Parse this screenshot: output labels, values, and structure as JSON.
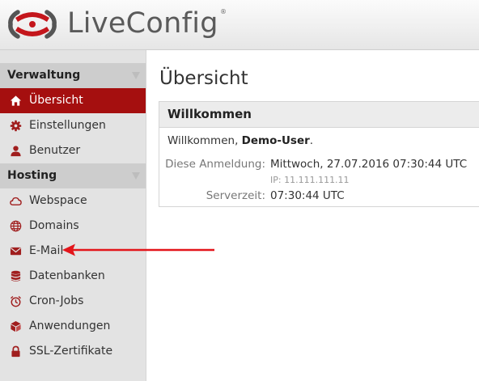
{
  "header": {
    "brand": "LiveConfig",
    "reg_mark": "®",
    "logo_icon": "liveconfig-logo-icon",
    "accent": "#a50f0f"
  },
  "sidebar": {
    "sections": [
      {
        "title": "Verwaltung",
        "items": [
          {
            "label": "Übersicht",
            "icon": "home-icon",
            "active": true
          },
          {
            "label": "Einstellungen",
            "icon": "gear-icon"
          },
          {
            "label": "Benutzer",
            "icon": "user-icon"
          }
        ]
      },
      {
        "title": "Hosting",
        "items": [
          {
            "label": "Webspace",
            "icon": "cloud-icon"
          },
          {
            "label": "Domains",
            "icon": "globe-icon"
          },
          {
            "label": "E-Mail",
            "icon": "envelope-icon"
          },
          {
            "label": "Datenbanken",
            "icon": "database-icon"
          },
          {
            "label": "Cron-Jobs",
            "icon": "alarm-clock-icon"
          },
          {
            "label": "Anwendungen",
            "icon": "cube-icon"
          },
          {
            "label": "SSL-Zertifikate",
            "icon": "lock-icon"
          }
        ]
      }
    ]
  },
  "main": {
    "title": "Übersicht",
    "panel": {
      "title": "Willkommen",
      "greeting_prefix": "Willkommen, ",
      "user": "Demo-User",
      "greeting_suffix": ".",
      "last_login_label": "Diese Anmeldung:",
      "last_login_value": "Mittwoch, 27.07.2016 07:30:44 UTC",
      "ip": "IP: 11.111.111.11",
      "server_time_label": "Serverzeit:",
      "server_time_value": "07:30:44 UTC"
    }
  },
  "annotation": {
    "arrow_color": "#e3151b",
    "points_to": "E-Mail"
  }
}
